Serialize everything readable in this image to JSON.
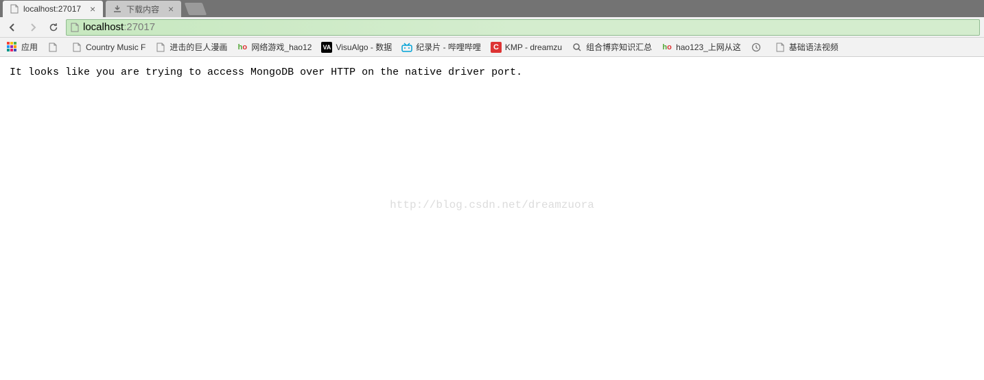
{
  "tabs": [
    {
      "title": "localhost:27017",
      "active": true,
      "iconType": "doc"
    },
    {
      "title": "下载内容",
      "active": false,
      "iconType": "download"
    }
  ],
  "address": {
    "host": "localhost",
    "port": ":27017"
  },
  "bookmarks": {
    "apps_label": "应用",
    "items": [
      {
        "label": "",
        "icon": "doc"
      },
      {
        "label": "Country Music F",
        "icon": "doc"
      },
      {
        "label": "进击的巨人漫画",
        "icon": "doc"
      },
      {
        "label": "网络游戏_hao12",
        "icon": "hao"
      },
      {
        "label": "VisuAlgo - 数据",
        "icon": "va"
      },
      {
        "label": "纪录片 - 哔哩哔哩",
        "icon": "bili"
      },
      {
        "label": "KMP - dreamzu",
        "icon": "c"
      },
      {
        "label": "组合博弈知识汇总",
        "icon": "ss"
      },
      {
        "label": "hao123_上网从这",
        "icon": "hao"
      },
      {
        "label": "",
        "icon": "hist"
      },
      {
        "label": "基础语法视频",
        "icon": "doc"
      }
    ]
  },
  "page": {
    "body_text": "It looks like you are trying to access MongoDB over HTTP on the native driver port."
  },
  "watermark": "http://blog.csdn.net/dreamzuora"
}
